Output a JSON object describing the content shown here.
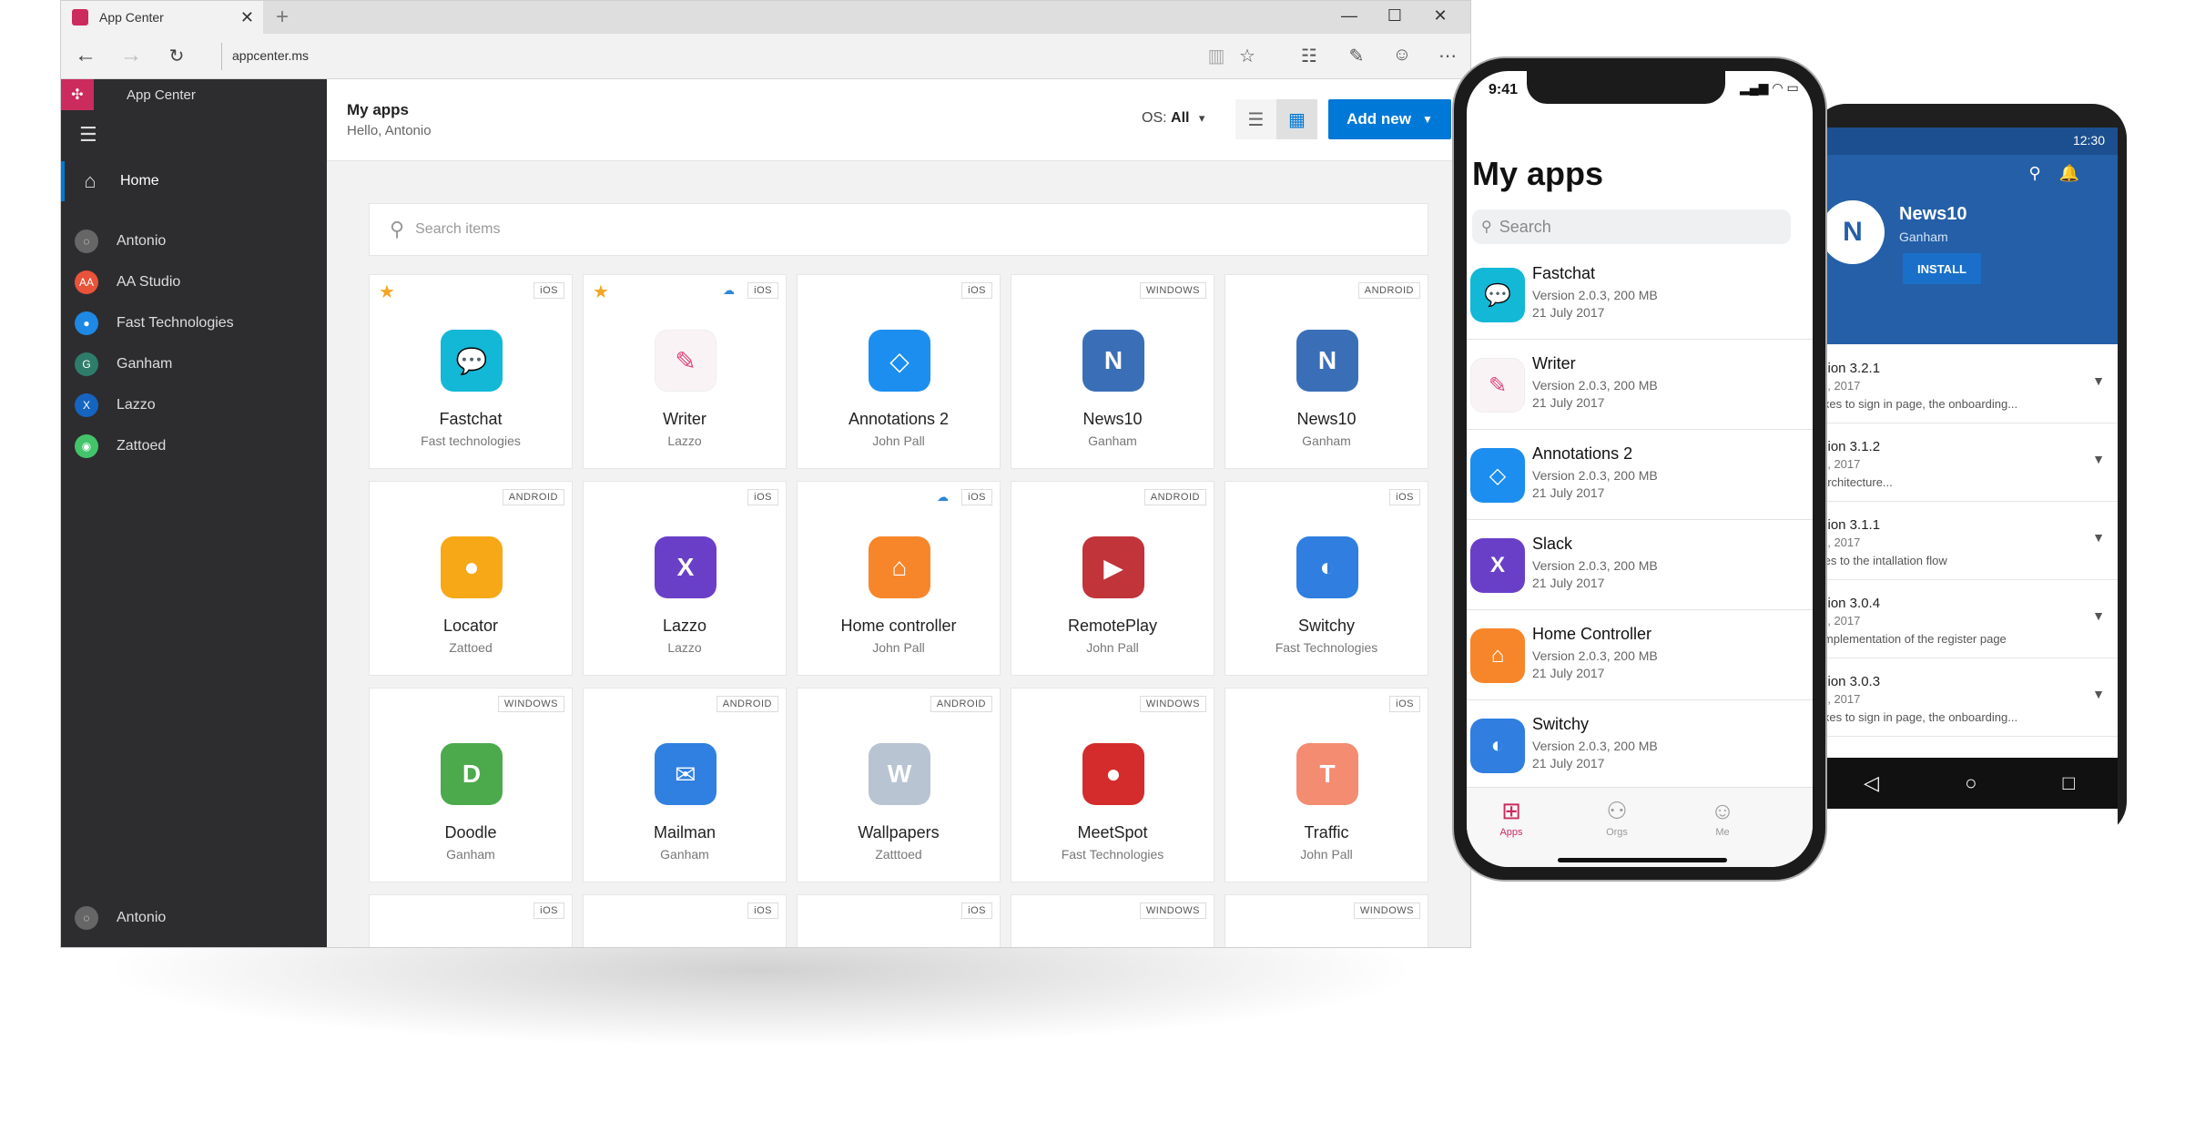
{
  "browser": {
    "tab_title": "App Center",
    "url": "appcenter.ms"
  },
  "sidebar": {
    "app_name": "App Center",
    "home": "Home",
    "orgs": [
      {
        "label": "Antonio",
        "color": "#666666",
        "glyph": "◌"
      },
      {
        "label": "AA Studio",
        "color": "#e8533a",
        "glyph": "AA"
      },
      {
        "label": "Fast Technologies",
        "color": "#1e88e5",
        "glyph": "●"
      },
      {
        "label": "Ganham",
        "color": "#2e7d6a",
        "glyph": "G"
      },
      {
        "label": "Lazzo",
        "color": "#1565c0",
        "glyph": "X"
      },
      {
        "label": "Zattoed",
        "color": "#43c46a",
        "glyph": "◉"
      }
    ],
    "user": "Antonio"
  },
  "header": {
    "title": "My apps",
    "subtitle": "Hello, Antonio",
    "os_label": "OS:",
    "os_value": "All",
    "add_new": "Add new"
  },
  "search": {
    "placeholder": "Search items"
  },
  "apps": [
    {
      "name": "Fastchat",
      "owner": "Fast technologies",
      "platform": "iOS",
      "starred": true,
      "cloud": false,
      "color": "#12b8d6",
      "glyph": "💬"
    },
    {
      "name": "Writer",
      "owner": "Lazzo",
      "platform": "iOS",
      "starred": true,
      "cloud": true,
      "color": "#f9f3f6",
      "glyph": "✎"
    },
    {
      "name": "Annotations 2",
      "owner": "John Pall",
      "platform": "iOS",
      "starred": false,
      "cloud": false,
      "color": "#1c8ef0",
      "glyph": "◇"
    },
    {
      "name": "News10",
      "owner": "Ganham",
      "platform": "WINDOWS",
      "starred": false,
      "cloud": false,
      "color": "#3a6fb8",
      "glyph": "N"
    },
    {
      "name": "News10",
      "owner": "Ganham",
      "platform": "ANDROID",
      "starred": false,
      "cloud": false,
      "color": "#3a6fb8",
      "glyph": "N"
    },
    {
      "name": "Locator",
      "owner": "Zattoed",
      "platform": "ANDROID",
      "starred": false,
      "cloud": false,
      "color": "#f6a816",
      "glyph": "●"
    },
    {
      "name": "Lazzo",
      "owner": "Lazzo",
      "platform": "iOS",
      "starred": false,
      "cloud": false,
      "color": "#6a3fc8",
      "glyph": "X"
    },
    {
      "name": "Home controller",
      "owner": "John Pall",
      "platform": "iOS",
      "starred": false,
      "cloud": true,
      "color": "#f7862a",
      "glyph": "⌂"
    },
    {
      "name": "RemotePlay",
      "owner": "John Pall",
      "platform": "ANDROID",
      "starred": false,
      "cloud": false,
      "color": "#c0343a",
      "glyph": "▶"
    },
    {
      "name": "Switchy",
      "owner": "Fast Technologies",
      "platform": "iOS",
      "starred": false,
      "cloud": false,
      "color": "#2f7ee0",
      "glyph": "◐"
    },
    {
      "name": "Doodle",
      "owner": "Ganham",
      "platform": "WINDOWS",
      "starred": false,
      "cloud": false,
      "color": "#4caa4c",
      "glyph": "D"
    },
    {
      "name": "Mailman",
      "owner": "Ganham",
      "platform": "ANDROID",
      "starred": false,
      "cloud": false,
      "color": "#2f80e0",
      "glyph": "✉"
    },
    {
      "name": "Wallpapers",
      "owner": "Zatttoed",
      "platform": "ANDROID",
      "starred": false,
      "cloud": false,
      "color": "#b8c4d2",
      "glyph": "W"
    },
    {
      "name": "MeetSpot",
      "owner": "Fast Technologies",
      "platform": "WINDOWS",
      "starred": false,
      "cloud": false,
      "color": "#d42c2c",
      "glyph": "●"
    },
    {
      "name": "Traffic",
      "owner": "John Pall",
      "platform": "iOS",
      "starred": false,
      "cloud": false,
      "color": "#f48c72",
      "glyph": "T"
    },
    {
      "name": "",
      "owner": "",
      "platform": "iOS",
      "starred": false,
      "cloud": false,
      "color": "",
      "glyph": ""
    },
    {
      "name": "",
      "owner": "",
      "platform": "iOS",
      "starred": false,
      "cloud": false,
      "color": "",
      "glyph": ""
    },
    {
      "name": "",
      "owner": "",
      "platform": "iOS",
      "starred": false,
      "cloud": false,
      "color": "",
      "glyph": ""
    },
    {
      "name": "",
      "owner": "",
      "platform": "WINDOWS",
      "starred": false,
      "cloud": false,
      "color": "",
      "glyph": ""
    },
    {
      "name": "",
      "owner": "",
      "platform": "WINDOWS",
      "starred": false,
      "cloud": false,
      "color": "",
      "glyph": ""
    }
  ],
  "iphone": {
    "time": "9:41",
    "title": "My apps",
    "search_placeholder": "Search",
    "apps": [
      {
        "name": "Fastchat",
        "version": "Version 2.0.3, 200 MB",
        "date": "21 July 2017",
        "color": "#12b8d6",
        "glyph": "💬"
      },
      {
        "name": "Writer",
        "version": "Version 2.0.3, 200 MB",
        "date": "21 July 2017",
        "color": "#f9f3f6",
        "glyph": "✎"
      },
      {
        "name": "Annotations 2",
        "version": "Version 2.0.3, 200 MB",
        "date": "21 July 2017",
        "color": "#1c8ef0",
        "glyph": "◇"
      },
      {
        "name": "Slack",
        "version": "Version 2.0.3, 200 MB",
        "date": "21 July 2017",
        "color": "#6a3fc8",
        "glyph": "X"
      },
      {
        "name": "Home Controller",
        "version": "Version 2.0.3, 200 MB",
        "date": "21 July 2017",
        "color": "#f7862a",
        "glyph": "⌂"
      },
      {
        "name": "Switchy",
        "version": "Version 2.0.3, 200 MB",
        "date": "21 July 2017",
        "color": "#2f7ee0",
        "glyph": "◐"
      }
    ],
    "tabs": [
      "Apps",
      "Orgs",
      "Me"
    ]
  },
  "android": {
    "time": "12:30",
    "app_name": "News10",
    "owner": "Ganham",
    "install": "INSTALL",
    "versions": [
      {
        "version": "sion 3.2.1",
        "date": "1, 2017",
        "note": "ixes to sign in page, the onboarding..."
      },
      {
        "version": "sion 3.1.2",
        "date": "1, 2017",
        "note": "architecture..."
      },
      {
        "version": "sion 3.1.1",
        "date": "1, 2017",
        "note": "tes to the intallation flow"
      },
      {
        "version": "sion 3.0.4",
        "date": "1, 2017",
        "note": "implementation of the register page"
      },
      {
        "version": "sion 3.0.3",
        "date": "1, 2017",
        "note": "ixes to sign in page, the onboarding..."
      }
    ]
  }
}
